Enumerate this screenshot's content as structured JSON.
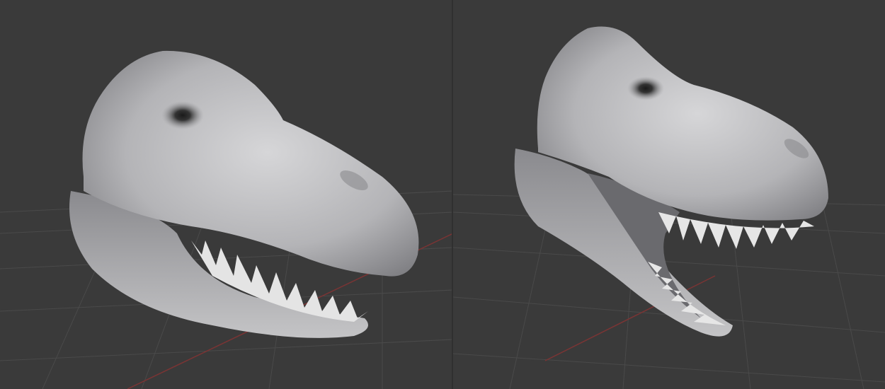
{
  "scene": {
    "description_free": true,
    "views": [
      {
        "id": "left-view",
        "model": "trex-head-closed-jaw"
      },
      {
        "id": "right-view",
        "model": "trex-head-open-jaw"
      }
    ]
  },
  "colors": {
    "background": "#3a3a3a",
    "grid": "#4a4a4a",
    "x_axis": "#7a3434",
    "model_light": "#d4d4d6",
    "model_mid": "#a9a9ac",
    "model_dark": "#6e6e72",
    "teeth": "#e6e6e6"
  }
}
